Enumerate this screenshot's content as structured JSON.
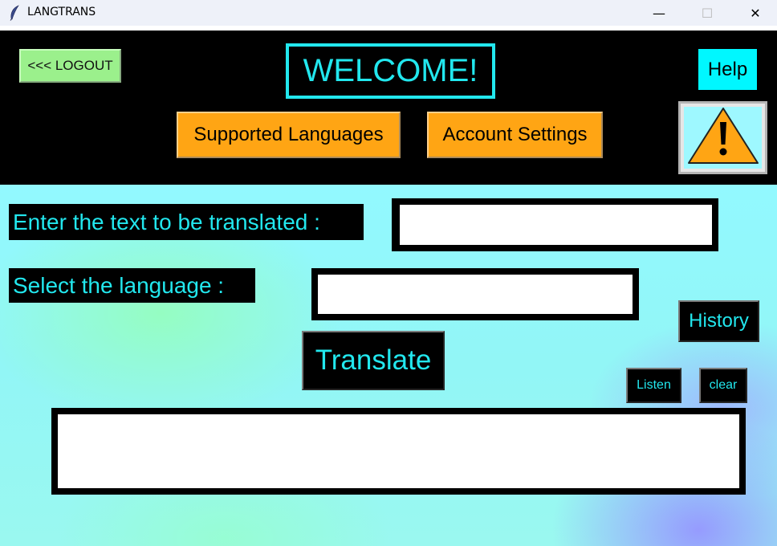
{
  "window": {
    "title": "LANGTRANS",
    "minimize_glyph": "—",
    "maximize_glyph": "☐",
    "close_glyph": "✕"
  },
  "header": {
    "logout_label": "<<< LOGOUT",
    "welcome_text": "WELCOME!",
    "help_label": "Help",
    "supported_languages_label": "Supported Languages",
    "account_settings_label": "Account Settings",
    "warning_icon": "warning-icon"
  },
  "form": {
    "text_label": "Enter the text to be translated :",
    "text_value": "",
    "language_label": "Select the language :",
    "language_value": ""
  },
  "actions": {
    "history_label": "History",
    "translate_label": "Translate",
    "listen_label": "Listen",
    "clear_label": "clear"
  },
  "output": {
    "value": ""
  },
  "colors": {
    "accent_cyan": "#22e7ee",
    "orange": "#ffa514",
    "logout_green": "#9bf08c",
    "help_cyan": "#00f7ff"
  }
}
